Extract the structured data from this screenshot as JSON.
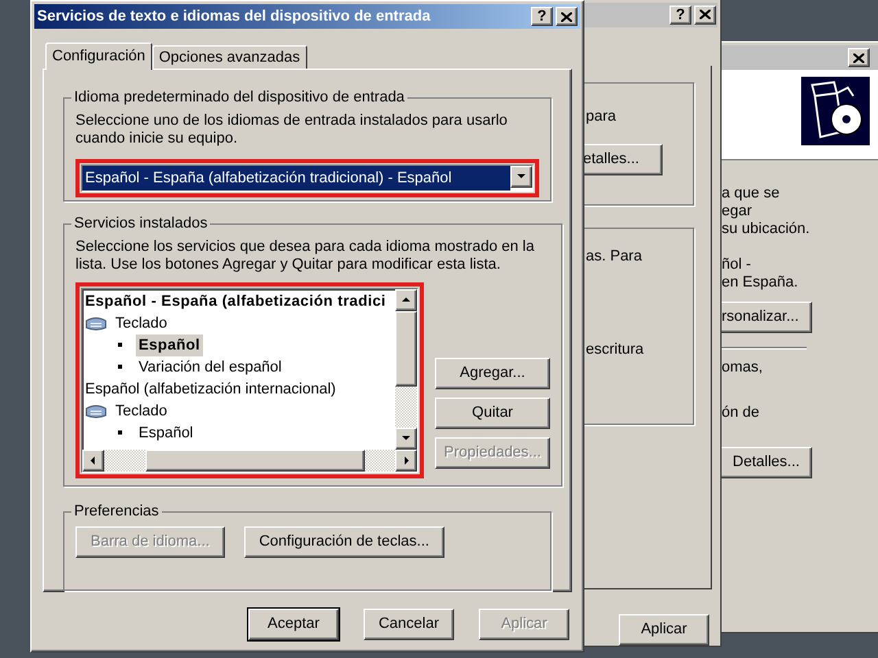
{
  "main_window": {
    "title": "Servicios de texto e idiomas del dispositivo de entrada",
    "help": "?",
    "tabs": [
      {
        "label": "Configuración",
        "selected": true
      },
      {
        "label": "Opciones avanzadas",
        "selected": false
      }
    ],
    "default_language": {
      "legend": "Idioma predeterminado del dispositivo de entrada",
      "description": "Seleccione uno de los idiomas de entrada instalados para usarlo cuando inicie su equipo.",
      "value": "Español - España (alfabetización tradicional) - Español"
    },
    "installed_services": {
      "legend": "Servicios instalados",
      "description": "Seleccione los servicios que desea para cada idioma mostrado en la lista. Use los botones Agregar y Quitar para modificar esta lista.",
      "tree": [
        {
          "kind": "language",
          "text": "Español - España (alfabetización tradici",
          "default": true,
          "children": [
            {
              "kind": "keyboard",
              "text": "Teclado",
              "children": [
                {
                  "kind": "service",
                  "text": "Español",
                  "default": true,
                  "selected": true
                },
                {
                  "kind": "service",
                  "text": "Variación del español",
                  "default": false,
                  "selected": false
                }
              ]
            }
          ]
        },
        {
          "kind": "language",
          "text": "Español (alfabetización internacional)",
          "default": false,
          "children": [
            {
              "kind": "keyboard",
              "text": "Teclado",
              "children": [
                {
                  "kind": "service",
                  "text": "Español",
                  "default": false,
                  "selected": false
                }
              ]
            }
          ]
        }
      ],
      "buttons": [
        {
          "label": "Agregar...",
          "disabled": false
        },
        {
          "label": "Quitar",
          "disabled": false
        },
        {
          "label": "Propiedades...",
          "disabled": true
        }
      ]
    },
    "preferences": {
      "legend": "Preferencias",
      "buttons": [
        {
          "label": "Barra de idioma...",
          "disabled": true
        },
        {
          "label": "Configuración de teclas...",
          "disabled": false
        }
      ]
    },
    "buttons": [
      {
        "label": "Aceptar",
        "default": true,
        "disabled": false
      },
      {
        "label": "Cancelar",
        "default": false,
        "disabled": false
      },
      {
        "label": "Aplicar",
        "default": false,
        "disabled": true
      }
    ]
  },
  "middle_window": {
    "help": "?",
    "group_1": {
      "text": "para",
      "button": "etalles..."
    },
    "group_2": {
      "texts": [
        "as. Para",
        "escritura"
      ]
    },
    "apply_button": "Aplicar"
  },
  "back_window": {
    "group_1": [
      "a que se",
      "egar",
      "su ubicación.",
      "ñol -",
      "en España."
    ],
    "button_1": "rsonalizar...",
    "group_2": [
      "omas,",
      "ón de"
    ],
    "button_2": "Detalles..."
  }
}
